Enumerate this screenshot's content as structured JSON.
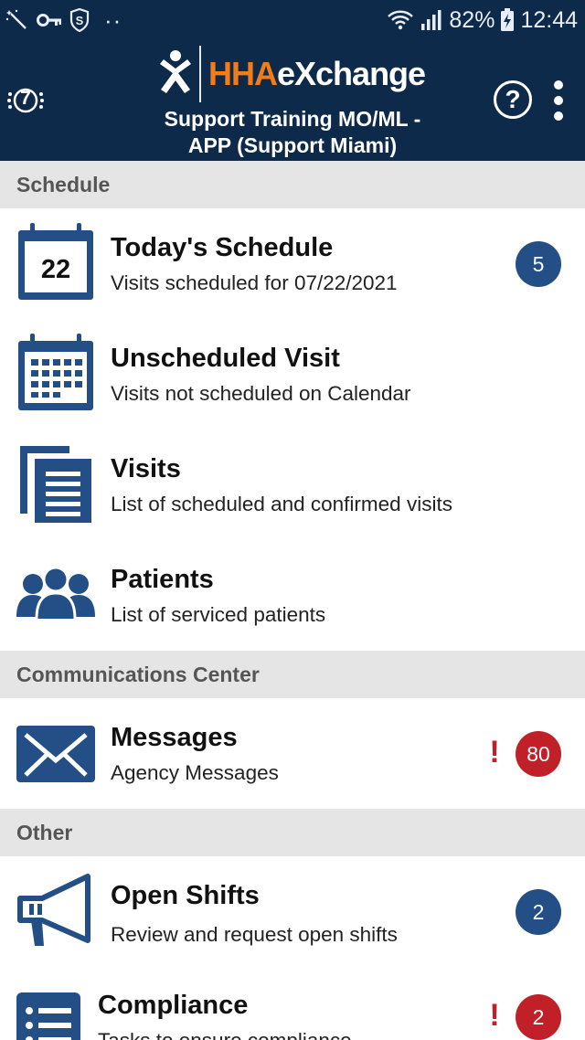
{
  "status_bar": {
    "battery": "82%",
    "time": "12:44",
    "dots": "··",
    "icons": [
      "magic-wand-icon",
      "key-icon",
      "s-shield-icon",
      "wifi-icon",
      "signal-icon",
      "battery-charging-icon"
    ]
  },
  "header": {
    "logo_hha": "HHA",
    "logo_exchange": "eXchange",
    "agency_name_line1": "Support Training MO/ML -",
    "agency_name_line2": "APP (Support Miami)",
    "left_icon": "accessibility-7-icon",
    "left_icon_text": "7",
    "help_label": "?",
    "colors": {
      "background": "#0d2a4a",
      "logo_orange": "#f07d1c",
      "accent_blue": "#244f86",
      "alert_red": "#c02028"
    }
  },
  "sections": {
    "schedule": "Schedule",
    "communications": "Communications Center",
    "other": "Other"
  },
  "rows": {
    "todays_schedule": {
      "title": "Today's Schedule",
      "subtitle": "Visits scheduled for 07/22/2021",
      "calendar_day": "22",
      "badge": "5",
      "icon": "calendar-day-icon"
    },
    "unscheduled_visit": {
      "title": "Unscheduled Visit",
      "subtitle": "Visits not scheduled on Calendar",
      "icon": "calendar-grid-icon"
    },
    "visits": {
      "title": "Visits",
      "subtitle": "List of scheduled and confirmed visits",
      "icon": "documents-list-icon"
    },
    "patients": {
      "title": "Patients",
      "subtitle": "List of serviced patients",
      "icon": "people-group-icon"
    },
    "messages": {
      "title": "Messages",
      "subtitle": "Agency Messages",
      "badge": "80",
      "alert": "!",
      "icon": "envelope-icon"
    },
    "open_shifts": {
      "title": "Open Shifts",
      "subtitle": "Review and request open shifts",
      "badge": "2",
      "icon": "megaphone-icon"
    },
    "compliance": {
      "title": "Compliance",
      "subtitle": "Tasks to ensure compliance",
      "badge": "2",
      "alert": "!",
      "icon": "checklist-icon"
    }
  }
}
